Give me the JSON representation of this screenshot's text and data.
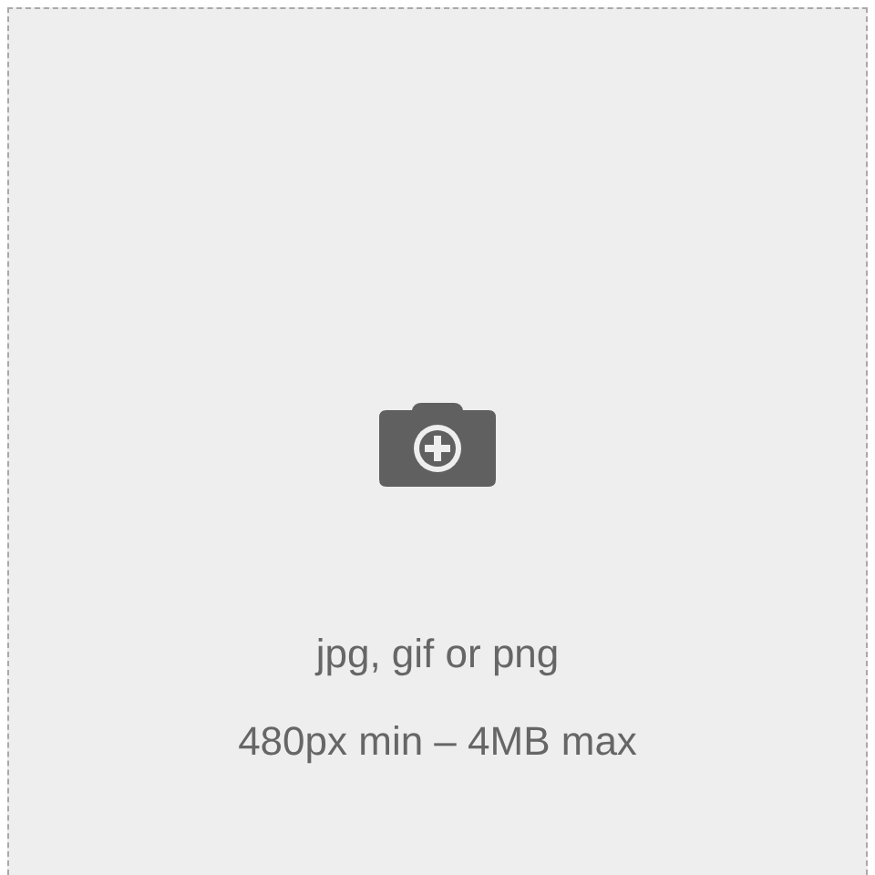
{
  "upload_area": {
    "formats": "jpg, gif or png",
    "limits": "480px min – 4MB max"
  }
}
